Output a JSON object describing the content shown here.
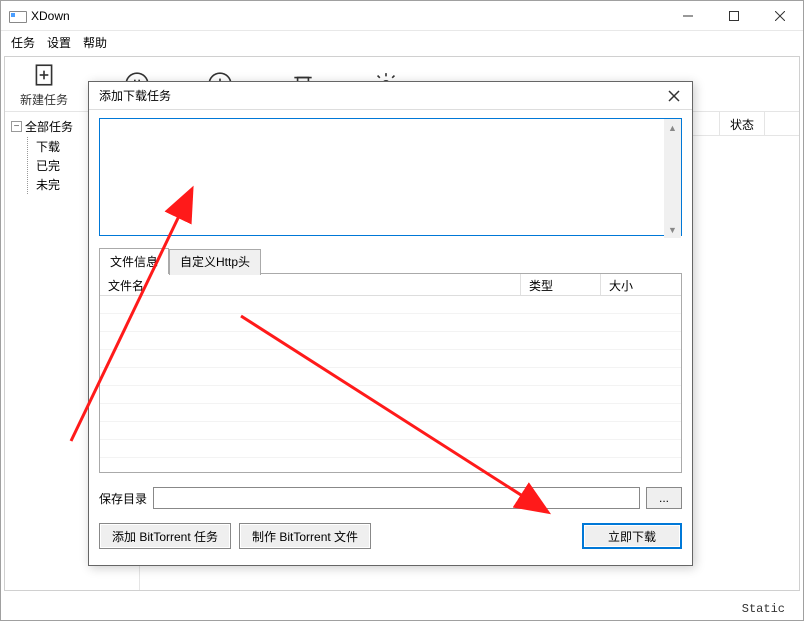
{
  "window": {
    "title": "XDown",
    "status": "Static"
  },
  "menu": {
    "task": "任务",
    "settings": "设置",
    "help": "帮助"
  },
  "toolbar": {
    "new_task": "新建任务"
  },
  "tree": {
    "root": "全部任务",
    "items": [
      "下载",
      "已完",
      "未完"
    ]
  },
  "list": {
    "columns": {
      "status": "状态"
    }
  },
  "dialog": {
    "title": "添加下载任务",
    "url_value": "",
    "tabs": {
      "file_info": "文件信息",
      "custom_http": "自定义Http头"
    },
    "file_columns": {
      "name": "文件名",
      "type": "类型",
      "size": "大小"
    },
    "save_label": "保存目录",
    "save_value": "",
    "browse": "...",
    "add_bt": "添加 BitTorrent 任务",
    "make_bt": "制作 BitTorrent 文件",
    "download_now": "立即下载"
  }
}
